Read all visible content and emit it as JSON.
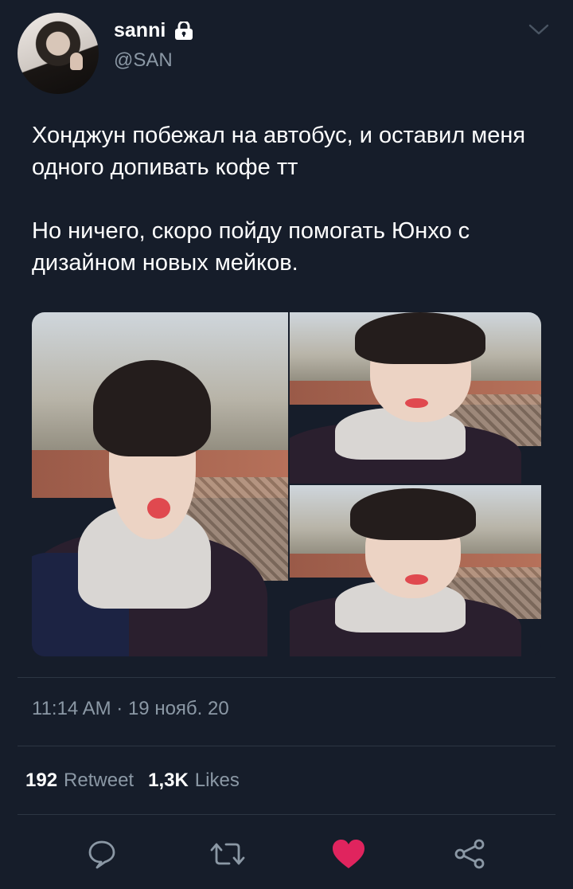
{
  "author": {
    "display_name": "sanni",
    "handle": "@SAN",
    "protected": true
  },
  "tweet": {
    "text": "Хонджун побежал на автобус, и оставил меня одного допивать кофе тт\n\nНо ничего, скоро пойду помогать Юнхо с дизайном новых мейков.",
    "timestamp": "11:14 AM · 19 нояб. 20",
    "photo_count": 3
  },
  "stats": {
    "retweets_count": "192",
    "retweets_label": "Retweet",
    "likes_count": "1,3K",
    "likes_label": "Likes"
  },
  "actions": [
    {
      "icon": "reply-icon"
    },
    {
      "icon": "retweet-icon"
    },
    {
      "icon": "heart-icon",
      "active": true,
      "color": "#e0245e"
    },
    {
      "icon": "share-icon"
    }
  ],
  "colors": {
    "background": "#161d2a",
    "secondary_text": "#8b98a5",
    "divider": "#2c3643",
    "like_active": "#e0245e"
  }
}
